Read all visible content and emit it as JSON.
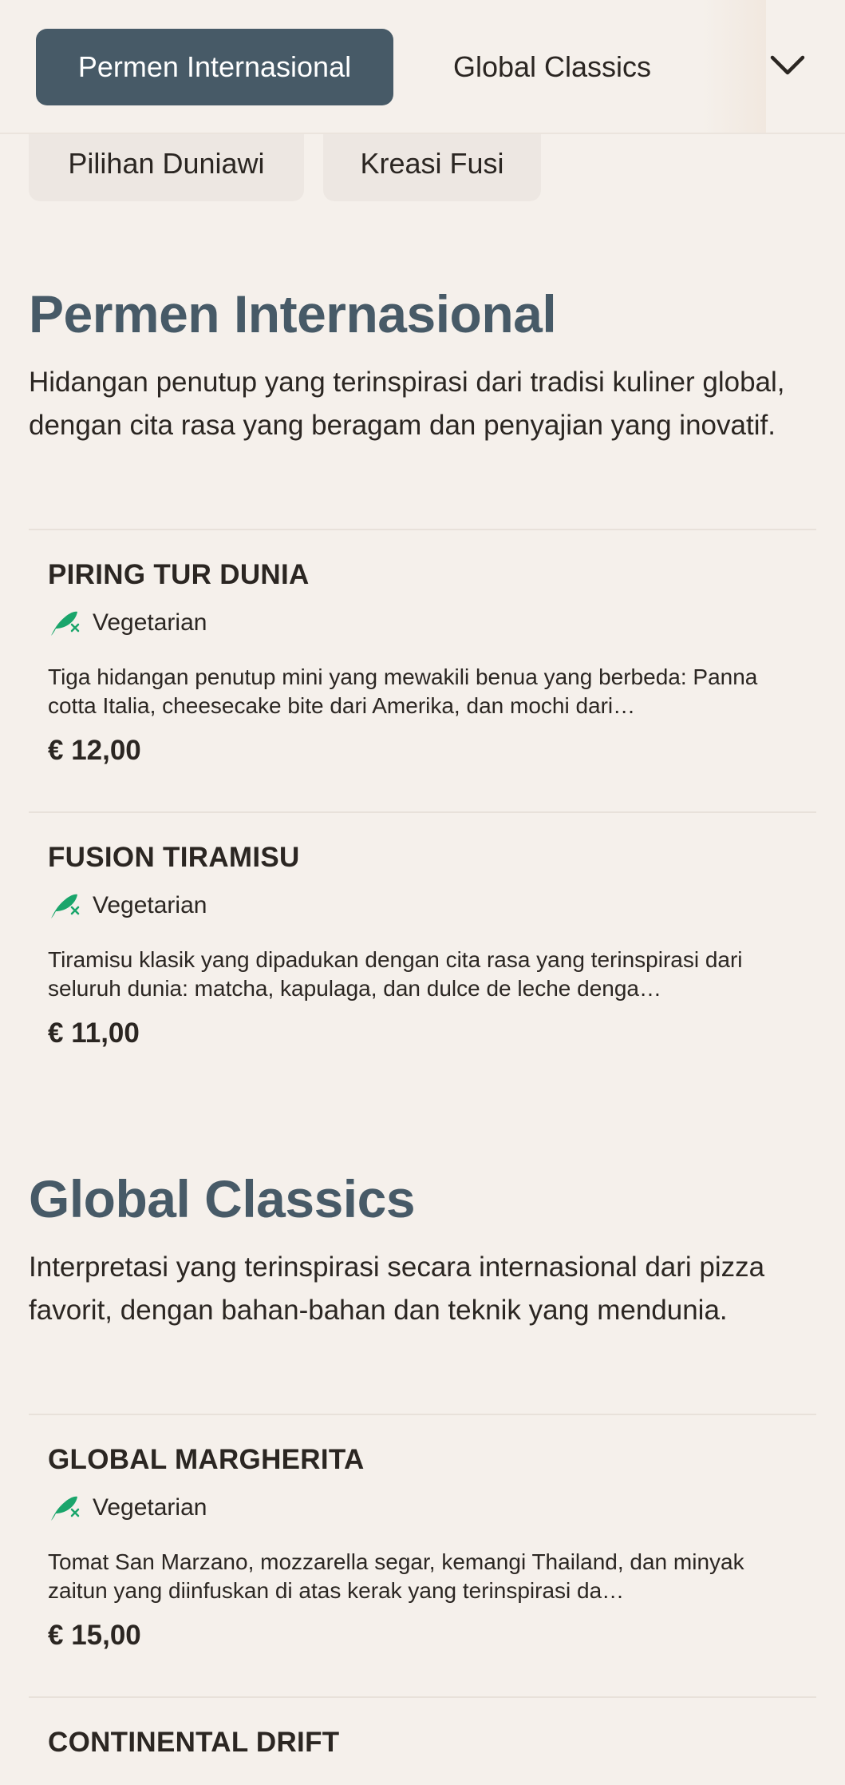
{
  "header": {
    "tabs": [
      {
        "label": "Permen Internasional",
        "active": true
      },
      {
        "label": "Global Classics",
        "active": false
      }
    ],
    "expand_icon": "chevron-down-icon",
    "pills": [
      {
        "label": "Pilihan Duniawi"
      },
      {
        "label": "Kreasi Fusi"
      }
    ]
  },
  "colors": {
    "accent": "#475a67",
    "background": "#f5f0eb",
    "vegetarian_icon": "#1aa56b"
  },
  "sections": [
    {
      "title": "Permen Internasional",
      "description": "Hidangan penutup yang terinspirasi dari tradisi kuliner global, dengan cita rasa yang beragam dan penyajian yang inovatif.",
      "items": [
        {
          "name": "PIRING TUR DUNIA",
          "diet_icon": "vegetarian-leaf-icon",
          "diet_label": "Vegetarian",
          "description": "Tiga hidangan penutup mini yang mewakili benua yang berbeda: Panna cotta Italia, cheesecake bite dari Amerika, dan mochi dari…",
          "price": "€ 12,00"
        },
        {
          "name": "FUSION TIRAMISU",
          "diet_icon": "vegetarian-leaf-icon",
          "diet_label": "Vegetarian",
          "description": "Tiramisu klasik yang dipadukan dengan cita rasa yang terinspirasi dari seluruh dunia: matcha, kapulaga, dan dulce de leche denga…",
          "price": "€ 11,00"
        }
      ]
    },
    {
      "title": "Global Classics",
      "description": "Interpretasi yang terinspirasi secara internasional dari pizza favorit, dengan bahan-bahan dan teknik yang mendunia.",
      "items": [
        {
          "name": "GLOBAL MARGHERITA",
          "diet_icon": "vegetarian-leaf-icon",
          "diet_label": "Vegetarian",
          "description": "Tomat San Marzano, mozzarella segar, kemangi Thailand, dan minyak zaitun yang diinfuskan di atas kerak yang terinspirasi da…",
          "price": "€ 15,00"
        },
        {
          "name": "CONTINENTAL DRIFT"
        }
      ]
    }
  ]
}
